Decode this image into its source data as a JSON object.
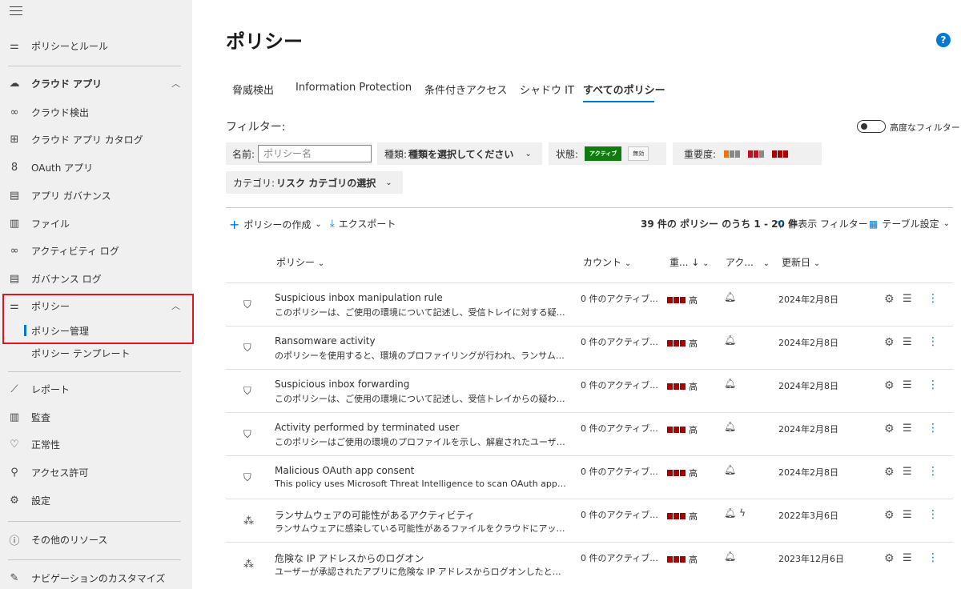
{
  "sidebar": {
    "items": [
      {
        "label": "ポリシーとルール",
        "icon": "sliders-icon"
      },
      {
        "label": "クラウド アプリ",
        "icon": "cloud-icon"
      },
      {
        "label": "クラウド検出",
        "icon": "binoculars-icon"
      },
      {
        "label": "クラウド アプリ カタログ",
        "icon": "catalog-icon"
      },
      {
        "label": "OAuth アプリ",
        "icon": "oauth-icon"
      },
      {
        "label": "アプリ ガバナンス",
        "icon": "clipboard-icon"
      },
      {
        "label": "ファイル",
        "icon": "file-icon"
      },
      {
        "label": "アクティビティ ログ",
        "icon": "glasses-icon"
      },
      {
        "label": "ガバナンス ログ",
        "icon": "clipboard-icon"
      },
      {
        "label": "ポリシー",
        "icon": "sliders-icon"
      },
      {
        "label": "ポリシー管理"
      },
      {
        "label": "ポリシー テンプレート"
      },
      {
        "label": "レポート",
        "icon": "chart-icon"
      },
      {
        "label": "監査",
        "icon": "audit-icon"
      },
      {
        "label": "正常性",
        "icon": "heart-icon"
      },
      {
        "label": "アクセス許可",
        "icon": "key-icon"
      },
      {
        "label": "設定",
        "icon": "gear-icon"
      },
      {
        "label": "その他のリソース",
        "icon": "info-icon"
      },
      {
        "label": "ナビゲーションのカスタマイズ",
        "icon": "pencil-icon"
      }
    ]
  },
  "page": {
    "title": "ポリシー",
    "help": "?"
  },
  "tabs": [
    {
      "label": "脅威検出"
    },
    {
      "label": "Information Protection"
    },
    {
      "label": "条件付きアクセス"
    },
    {
      "label": "シャドウ IT"
    },
    {
      "label": "すべてのポリシー"
    }
  ],
  "filters": {
    "label": "フィルター:",
    "advanced": "高度なフィルター",
    "name_label": "名前:",
    "name_placeholder": "ポリシー名",
    "type_label": "種類:",
    "type_value": "種類を選択してください",
    "status_label": "状態:",
    "status_active": "アクティブ",
    "status_disabled": "無効",
    "severity_label": "重要度:",
    "category_label": "カテゴリ:",
    "category_value": "リスク カテゴリの選択"
  },
  "toolbar": {
    "create": "ポリシーの作成",
    "export": "エクスポート",
    "count_text": "39 件の ポリシー のうち 1 - 20 件",
    "hide_filters": "非表示 フィルター",
    "table_settings": "テーブル設定"
  },
  "columns": {
    "policy": "ポリシー",
    "count": "カウント",
    "severity": "重...",
    "action": "アク...",
    "updated": "更新日"
  },
  "rows": [
    {
      "name": "Suspicious inbox manipulation rule",
      "desc": "このポリシーは、ご使用の環境について記述し、受信トレイに対する疑わし...",
      "count": "0 件のアクティブ...",
      "severity": "高",
      "date": "2024年2月8日",
      "icon": "shield-icon"
    },
    {
      "name": "Ransomware activity",
      "desc": "のポリシーを使用すると、環境のプロファイリングが行われ、ランサムウェ...",
      "count": "0 件のアクティブ...",
      "severity": "高",
      "date": "2024年2月8日",
      "icon": "shield-icon"
    },
    {
      "name": "Suspicious inbox forwarding",
      "desc": "このポリシーは、ご使用の環境について記述し、受信トレイからの疑わしい...",
      "count": "0 件のアクティブ...",
      "severity": "高",
      "date": "2024年2月8日",
      "icon": "shield-icon"
    },
    {
      "name": "Activity performed by terminated user",
      "desc": "このポリシーはご使用の環境のプロファイルを示し、解雇されたユーザーが...",
      "count": "0 件のアクティブ...",
      "severity": "高",
      "date": "2024年2月8日",
      "icon": "shield-icon"
    },
    {
      "name": "Malicious OAuth app consent",
      "desc": "This policy uses Microsoft Threat Intelligence to scan OAuth apps connected t...",
      "count": "0 件のアクティブ...",
      "severity": "高",
      "date": "2024年2月8日",
      "icon": "shield-icon"
    },
    {
      "name": "ランサムウェアの可能性があるアクティビティ",
      "desc": "ランサムウェアに感染している可能性があるファイルをクラウドにアップロ...",
      "count": "0 件のアクティブ...",
      "severity": "高",
      "date": "2022年3月6日",
      "icon": "run-icon",
      "extra_action": true
    },
    {
      "name": "危険な IP アドレスからのログオン",
      "desc": "ユーザーが承認されたアプリに危険な IP アドレスからログオンしたときに警...",
      "count": "0 件のアクティブ...",
      "severity": "高",
      "date": "2023年12月6日",
      "icon": "run-icon"
    }
  ],
  "colors": {
    "accent": "#0078d4",
    "severity": "#a80000",
    "active": "#107c10",
    "highlight": "#e3141e"
  }
}
